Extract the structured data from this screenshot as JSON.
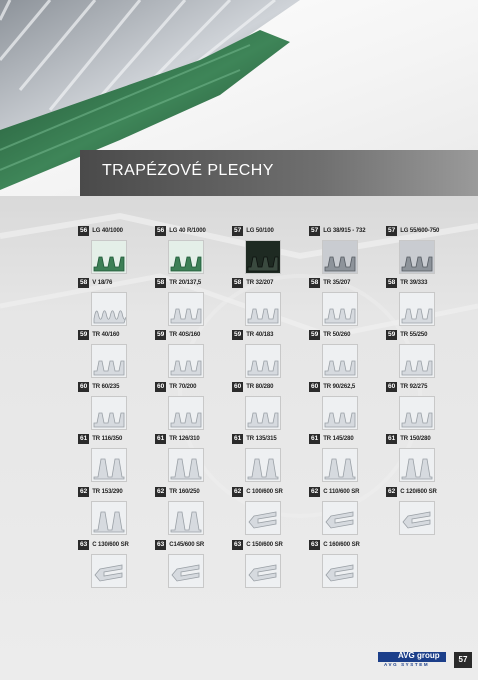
{
  "header": {
    "title": "TRAPÉZOVÉ PLECHY"
  },
  "colors": {
    "accent_green": "#2f6b45",
    "band_dark": "#4a4a4a",
    "brand_blue": "#1c3f8a"
  },
  "rows": [
    [
      {
        "page": "56",
        "name": "LG 40/1000",
        "icon": "green-trapezoid-sheet"
      },
      {
        "page": "56",
        "name": "LG 40 R/1000",
        "icon": "green-trapezoid-sheet"
      },
      {
        "page": "57",
        "name": "LG 50/100",
        "icon": "dark-tile-sheet"
      },
      {
        "page": "57",
        "name": "LG 38/915 - 732",
        "icon": "grey-trapezoid-sheet"
      },
      {
        "page": "57",
        "name": "LG 55/600-750",
        "icon": "grey-trapezoid-sheet"
      }
    ],
    [
      {
        "page": "58",
        "name": "V 18/76",
        "icon": "wave-sheet"
      },
      {
        "page": "58",
        "name": "TR 20/137,5",
        "icon": "trapezoid-sheet"
      },
      {
        "page": "58",
        "name": "TR 32/207",
        "icon": "trapezoid-sheet"
      },
      {
        "page": "58",
        "name": "TR 35/207",
        "icon": "trapezoid-sheet"
      },
      {
        "page": "58",
        "name": "TR 39/333",
        "icon": "trapezoid-sheet"
      }
    ],
    [
      {
        "page": "59",
        "name": "TR 40/160",
        "icon": "trapezoid-sheet"
      },
      {
        "page": "59",
        "name": "TR 40S/160",
        "icon": "trapezoid-sheet"
      },
      {
        "page": "59",
        "name": "TR 40/183",
        "icon": "trapezoid-sheet"
      },
      {
        "page": "59",
        "name": "TR 50/260",
        "icon": "trapezoid-sheet"
      },
      {
        "page": "59",
        "name": "TR 55/250",
        "icon": "trapezoid-sheet"
      }
    ],
    [
      {
        "page": "60",
        "name": "TR 60/235",
        "icon": "trapezoid-sheet"
      },
      {
        "page": "60",
        "name": "TR 70/200",
        "icon": "trapezoid-sheet"
      },
      {
        "page": "60",
        "name": "TR 80/280",
        "icon": "trapezoid-sheet"
      },
      {
        "page": "60",
        "name": "TR 90/262,5",
        "icon": "trapezoid-sheet"
      },
      {
        "page": "60",
        "name": "TR 92/275",
        "icon": "trapezoid-sheet"
      }
    ],
    [
      {
        "page": "61",
        "name": "TR 116/350",
        "icon": "deep-trapezoid-sheet"
      },
      {
        "page": "61",
        "name": "TR 126/310",
        "icon": "deep-trapezoid-sheet"
      },
      {
        "page": "61",
        "name": "TR 135/315",
        "icon": "deep-trapezoid-sheet"
      },
      {
        "page": "61",
        "name": "TR 145/280",
        "icon": "deep-trapezoid-sheet"
      },
      {
        "page": "61",
        "name": "TR 150/280",
        "icon": "deep-trapezoid-sheet"
      }
    ],
    [
      {
        "page": "62",
        "name": "TR 153/290",
        "icon": "deep-trapezoid-sheet"
      },
      {
        "page": "62",
        "name": "TR 160/250",
        "icon": "deep-trapezoid-sheet"
      },
      {
        "page": "62",
        "name": "C 100/600 SR",
        "icon": "c-profile"
      },
      {
        "page": "62",
        "name": "C 110/600 SR",
        "icon": "c-profile"
      },
      {
        "page": "62",
        "name": "C 120/600 SR",
        "icon": "c-profile"
      }
    ],
    [
      {
        "page": "63",
        "name": "C 130/600 SR",
        "icon": "c-profile"
      },
      {
        "page": "63",
        "name": "C145/600 SR",
        "icon": "c-profile"
      },
      {
        "page": "63",
        "name": "C 150/600 SR",
        "icon": "c-profile"
      },
      {
        "page": "63",
        "name": "C 160/600 SR",
        "icon": "c-profile"
      }
    ]
  ],
  "footer": {
    "logo_text": "AVG group",
    "logo_sub": "AVG SYSTEM",
    "page_number": "57"
  }
}
